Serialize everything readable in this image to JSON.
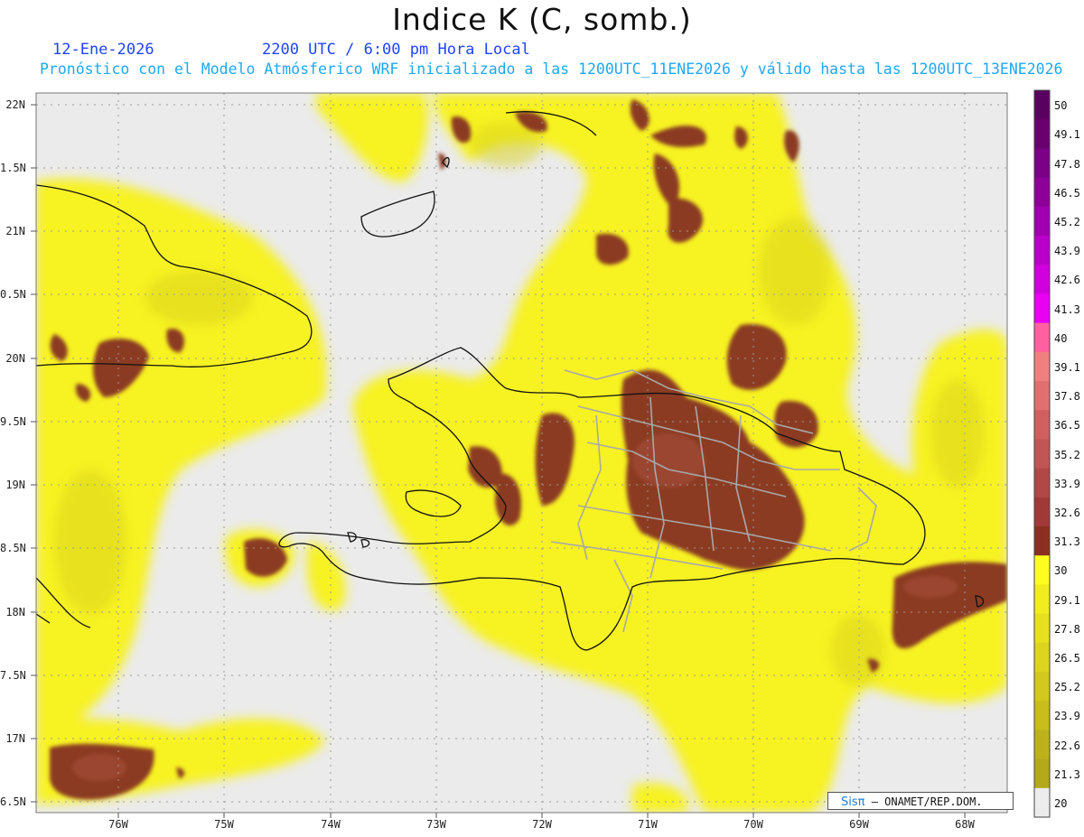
{
  "header": {
    "title": "Indice K (C, somb.)",
    "date": "12-Ene-2026",
    "time": "2200 UTC / 6:00 pm Hora Local",
    "description": "Pronóstico con el Modelo Atmósferico WRF inicializado a las 1200UTC_11ENE2026 y válido hasta las  1200UTC_13ENE2026"
  },
  "axes": {
    "y_ticks": [
      "22N",
      "1.5N",
      "21N",
      "0.5N",
      "20N",
      "9.5N",
      "19N",
      "8.5N",
      "18N",
      "7.5N",
      "17N",
      "6.5N"
    ],
    "x_ticks": [
      "76W",
      "75W",
      "74W",
      "73W",
      "72W",
      "71W",
      "70W",
      "69W",
      "68W"
    ]
  },
  "colorbar": {
    "labels": [
      "50",
      "49.1",
      "47.8",
      "46.5",
      "45.2",
      "43.9",
      "42.6",
      "41.3",
      "40",
      "39.1",
      "37.8",
      "36.5",
      "35.2",
      "33.9",
      "32.6",
      "31.3",
      "30",
      "29.1",
      "27.8",
      "26.5",
      "25.2",
      "23.9",
      "22.6",
      "21.3",
      "20"
    ],
    "colors": [
      "#5a0060",
      "#6a0070",
      "#7a0085",
      "#8c0098",
      "#a000b0",
      "#b800c8",
      "#d000dc",
      "#e800f0",
      "#ff60a0",
      "#f08080",
      "#e07070",
      "#d06060",
      "#c05555",
      "#b04848",
      "#a03a38",
      "#8b3020",
      "#fffc20",
      "#f0ec20",
      "#e6e020",
      "#dcd41f",
      "#d2c81e",
      "#c8bd1d",
      "#beb21c",
      "#b4a81b",
      "#ececec"
    ],
    "accent_low": "#ececec",
    "accent_k30": "#8b3a22"
  },
  "credit": {
    "logo": "Sisπ",
    "text": "– ONAMET/REP.DOM."
  }
}
